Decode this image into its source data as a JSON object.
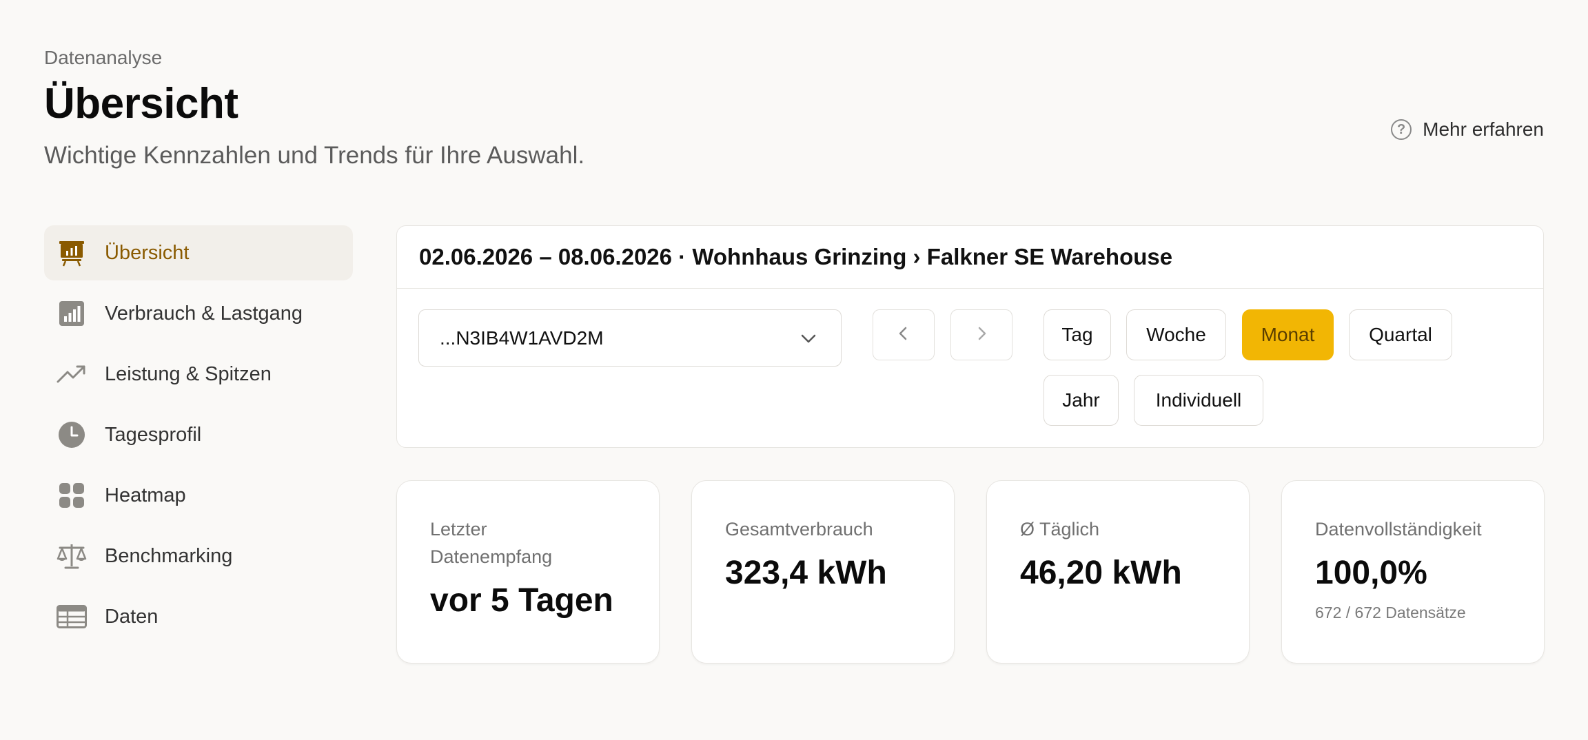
{
  "header": {
    "eyebrow": "Datenanalyse",
    "title": "Übersicht",
    "subtitle": "Wichtige Kennzahlen und Trends für Ihre Auswahl.",
    "learn_more": "Mehr erfahren"
  },
  "sidebar": {
    "items": [
      {
        "label": "Übersicht",
        "icon": "presentation-chart-icon",
        "active": true
      },
      {
        "label": "Verbrauch & Lastgang",
        "icon": "bar-chart-icon",
        "active": false
      },
      {
        "label": "Leistung & Spitzen",
        "icon": "trending-up-icon",
        "active": false
      },
      {
        "label": "Tagesprofil",
        "icon": "clock-icon",
        "active": false
      },
      {
        "label": "Heatmap",
        "icon": "grid-icon",
        "active": false
      },
      {
        "label": "Benchmarking",
        "icon": "scale-icon",
        "active": false
      },
      {
        "label": "Daten",
        "icon": "table-icon",
        "active": false
      }
    ]
  },
  "filter": {
    "heading": "02.06.2026 – 08.06.2026 · Wohnhaus Grinzing › Falkner SE Warehouse",
    "meter_select": "...N3IB4W1AVD2M",
    "periods": [
      {
        "label": "Tag",
        "active": false
      },
      {
        "label": "Woche",
        "active": false
      },
      {
        "label": "Monat",
        "active": true
      },
      {
        "label": "Quartal",
        "active": false
      },
      {
        "label": "Jahr",
        "active": false
      },
      {
        "label": "Individuell",
        "active": false
      }
    ]
  },
  "kpis": [
    {
      "label": "Letzter Datenempfang",
      "value": "vor 5 Tagen",
      "sub": ""
    },
    {
      "label": "Gesamtverbrauch",
      "value": "323,4 kWh",
      "sub": ""
    },
    {
      "label": "Ø Täglich",
      "value": "46,20 kWh",
      "sub": ""
    },
    {
      "label": "Datenvollständigkeit",
      "value": "100,0%",
      "sub": "672 / 672 Datensätze"
    }
  ],
  "colors": {
    "accent": "#f2b604",
    "active_text": "#8a5a00",
    "background": "#faf9f7",
    "icon_grey": "#8c8a85"
  }
}
